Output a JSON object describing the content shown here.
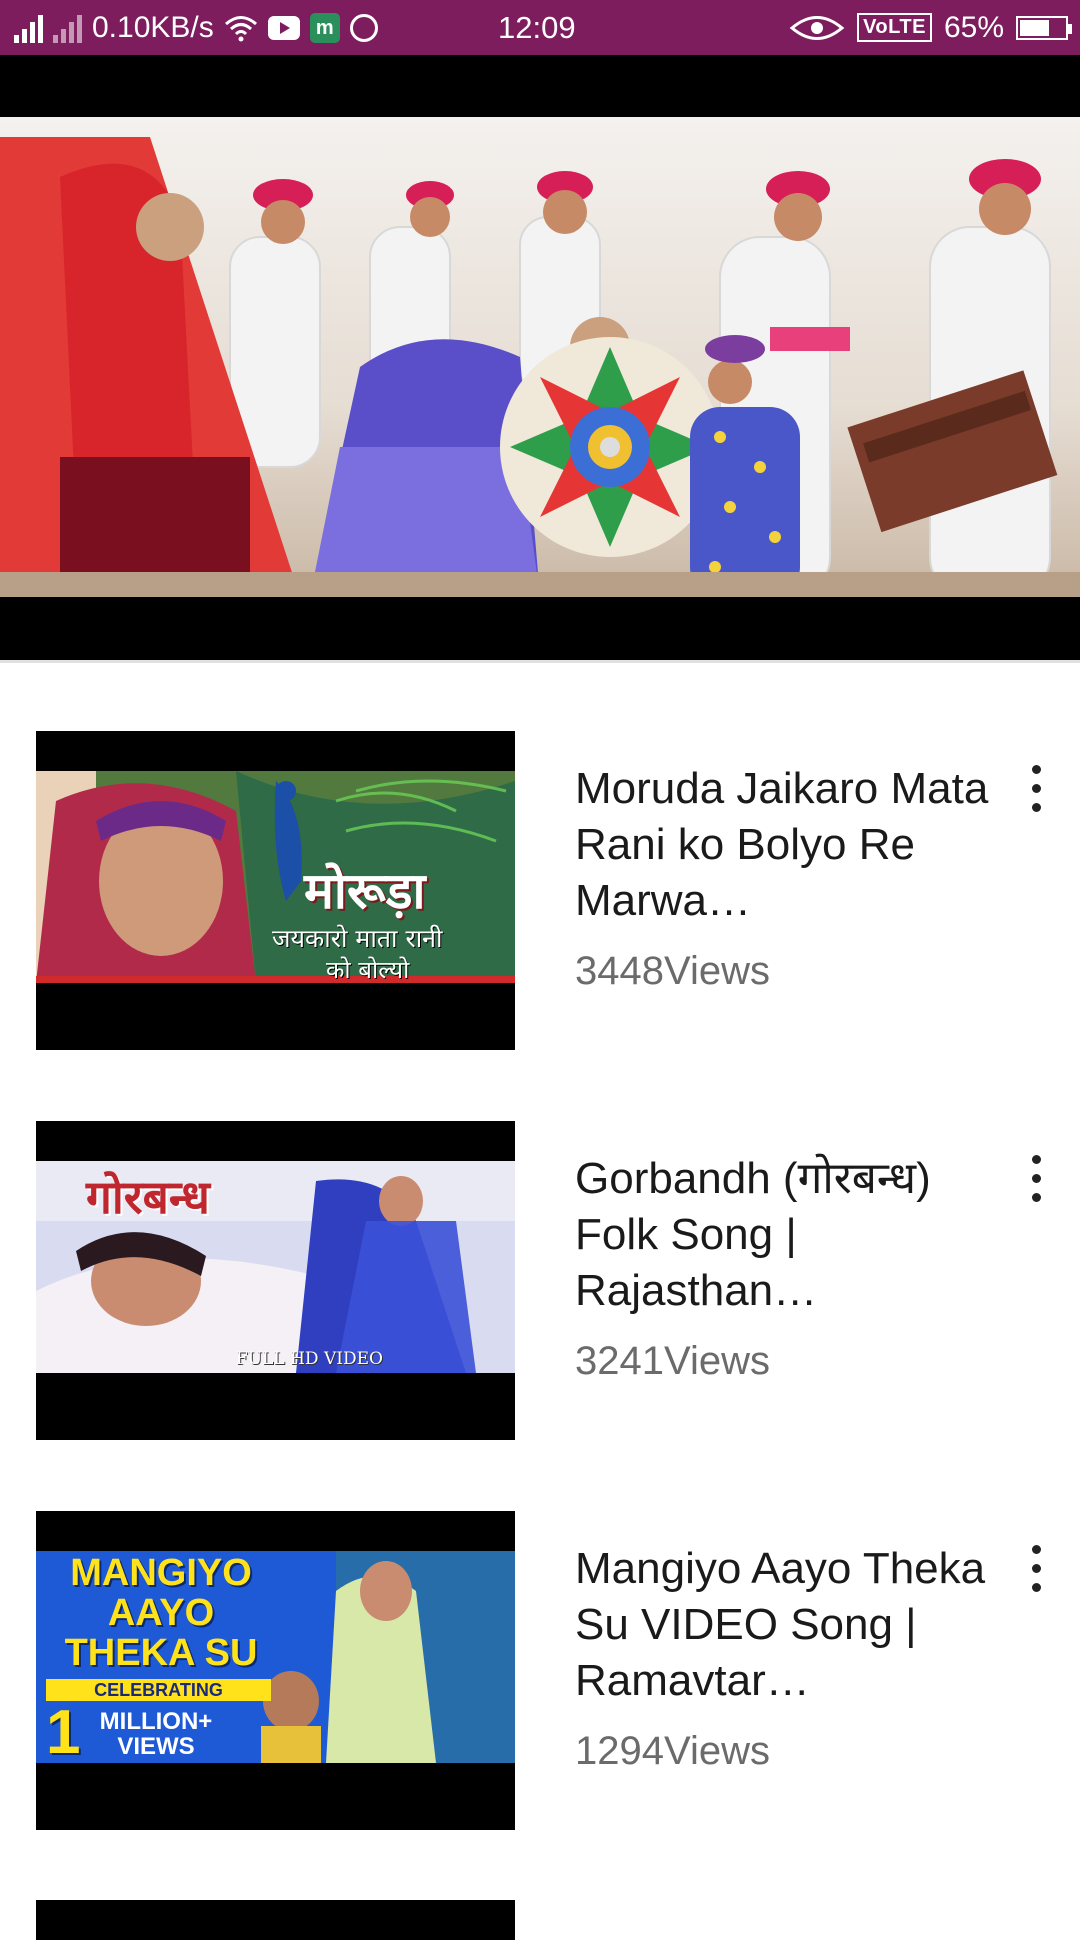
{
  "status_bar": {
    "network_speed": "0.10KB/s",
    "time": "12:09",
    "volte": "VoLTE",
    "battery": "65%",
    "battery_level": 0.65,
    "icons": [
      "signal-icon",
      "signal-dim-icon",
      "wifi-icon",
      "youtube-icon",
      "m-app-icon",
      "whatsapp-icon",
      "eye-icon",
      "volte-icon",
      "battery-icon"
    ]
  },
  "videos": [
    {
      "title": "Moruda Jaikaro Mata Rani ko Bolyo Re Marwa…",
      "views": "3448Views",
      "thumb_text": "मोरूड़ा",
      "thumb_subtext": "जयकारो माता रानी",
      "thumb_subtext2": "को बोल्यो"
    },
    {
      "title": "Gorbandh (गोरबन्ध) Folk Song | Rajasthan…",
      "views": "3241Views",
      "thumb_text": "गोरबन्ध",
      "thumb_subtext": "FULL HD VIDEO"
    },
    {
      "title": "Mangiyo Aayo Theka Su VIDEO Song | Ramavtar…",
      "views": "1294Views",
      "thumb_text": "MANGIYO AAYO THEKA SU",
      "thumb_badge": "CELEBRATING",
      "thumb_number": "1",
      "thumb_views": "MILLION+ VIEWS"
    }
  ],
  "colors": {
    "status_bar": "#7d1d5e",
    "title_text": "#1a1a1a",
    "views_text": "#6b6b6b"
  }
}
